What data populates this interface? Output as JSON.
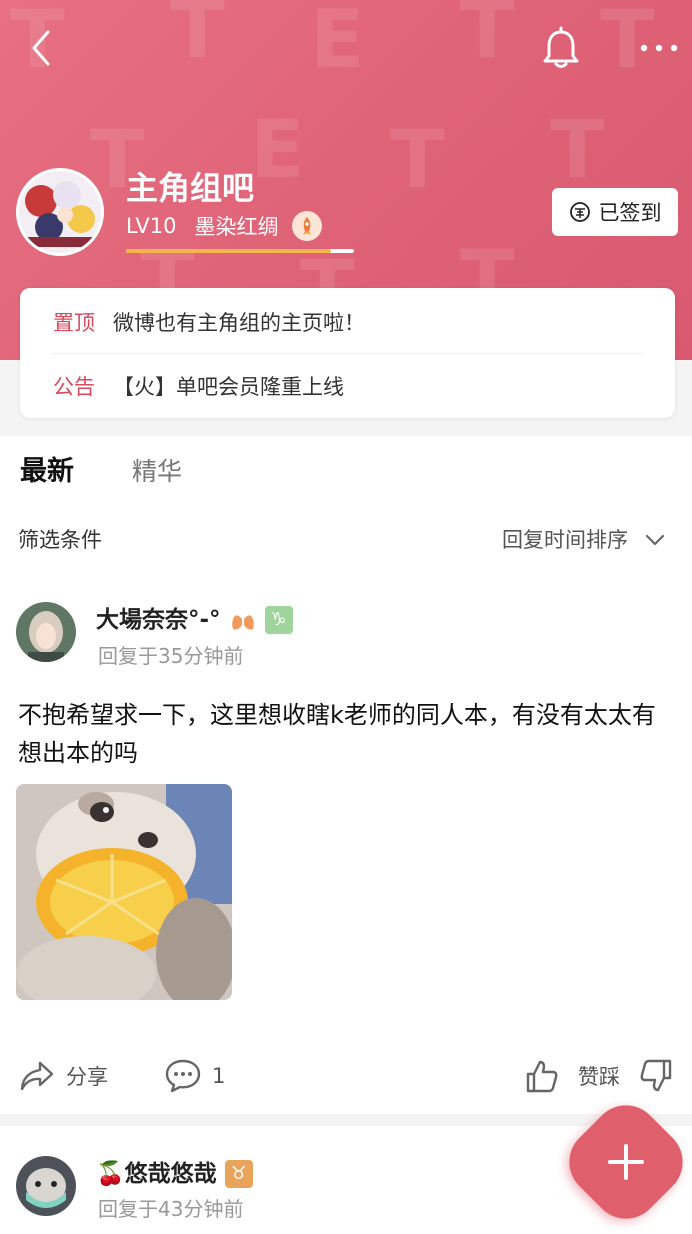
{
  "header": {
    "group_name": "主角组吧",
    "level": "LV10",
    "level_title": "墨染红绸",
    "level_progress": 0.9,
    "checkin_label": "已签到"
  },
  "notices": [
    {
      "tag": "置顶",
      "text": "微博也有主角组的主页啦！"
    },
    {
      "tag": "公告",
      "text": "【火】单吧会员隆重上线"
    }
  ],
  "tabs": [
    {
      "label": "最新",
      "active": true
    },
    {
      "label": "精华",
      "active": false
    }
  ],
  "filter": {
    "label": "筛选条件",
    "sort_label": "回复时间排序"
  },
  "posts": [
    {
      "author": "大場奈奈°-°",
      "time": "回复于35分钟前",
      "body": "不抱希望求一下，这里想收瞎k老师的同人本，有没有太太有想出本的吗",
      "share_label": "分享",
      "comment_count": "1",
      "vote_label": "赞踩"
    },
    {
      "author": "🍒悠哉悠哉",
      "time": "回复于43分钟前"
    }
  ],
  "colors": {
    "header_bg": "#e06a7e",
    "accent": "#d64b5e",
    "fab": "#e05f6d"
  }
}
